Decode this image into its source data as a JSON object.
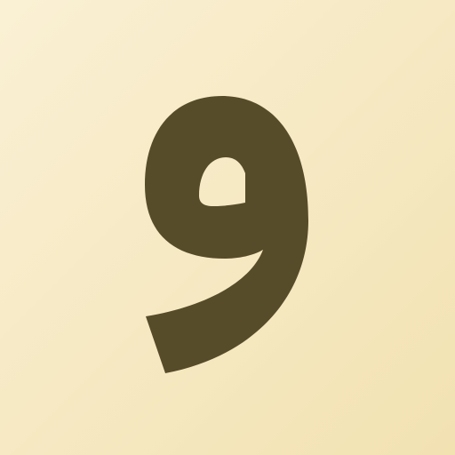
{
  "icon": {
    "name": "arabic-letter-waw-icon",
    "background_light": "#FAF0D4",
    "background_dark": "#F2E2B2",
    "glyph_color": "#574C2A"
  }
}
